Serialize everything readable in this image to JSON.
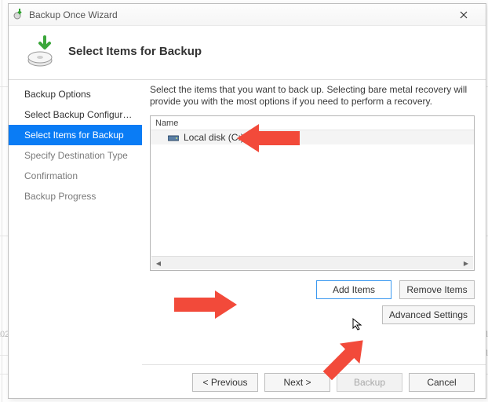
{
  "window": {
    "title": "Backup Once Wizard"
  },
  "header": {
    "heading": "Select Items for Backup"
  },
  "sidebar": {
    "steps": [
      {
        "label": "Backup Options",
        "state": "done"
      },
      {
        "label": "Select Backup Configurat...",
        "state": "done"
      },
      {
        "label": "Select Items for Backup",
        "state": "active"
      },
      {
        "label": "Specify Destination Type",
        "state": "future"
      },
      {
        "label": "Confirmation",
        "state": "future"
      },
      {
        "label": "Backup Progress",
        "state": "future"
      }
    ]
  },
  "main": {
    "instructions": "Select the items that you want to back up. Selecting bare metal recovery will provide you with the most options if you need to perform a recovery.",
    "list_header": "Name",
    "items": [
      {
        "label": "Local disk (C:)"
      }
    ],
    "buttons": {
      "add_items": "Add Items",
      "remove_items": "Remove Items",
      "advanced_settings": "Advanced Settings"
    }
  },
  "wizard_nav": {
    "previous": "< Previous",
    "next": "Next >",
    "backup": "Backup",
    "cancel": "Cancel"
  },
  "annotations": {
    "note": "Red arrows point to: Local disk (C:) item, Add Items button, and Advanced Settings button",
    "color": "#f24a3a"
  }
}
